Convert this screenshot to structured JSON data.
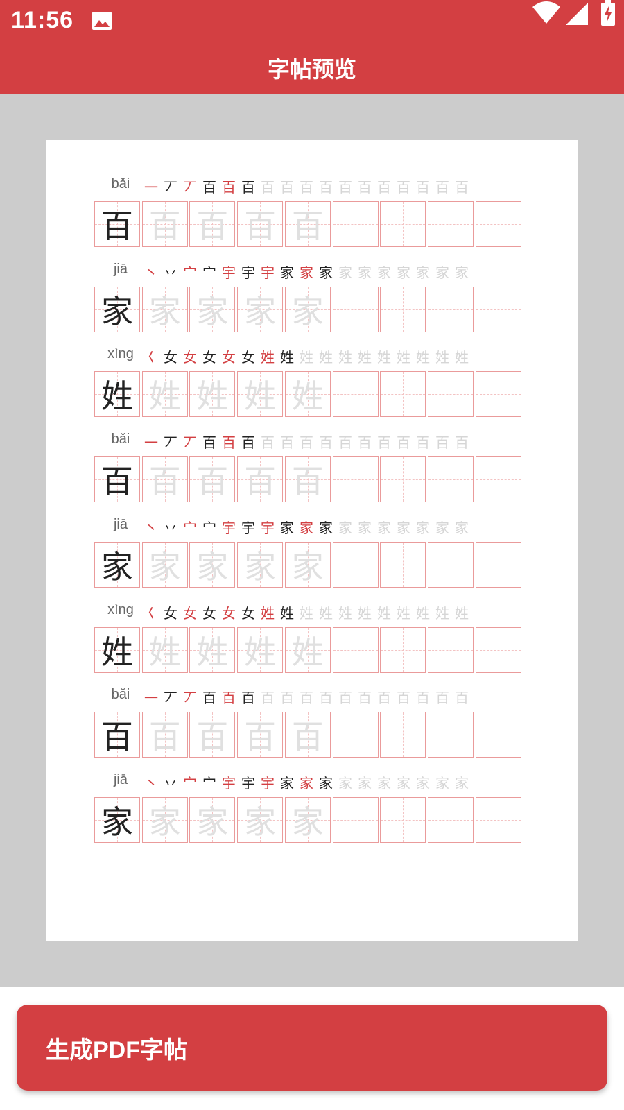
{
  "status_bar": {
    "time": "11:56",
    "icons": [
      "image-icon",
      "wifi-icon",
      "signal-icon",
      "battery-charging-icon"
    ]
  },
  "app_bar": {
    "title": "字帖预览"
  },
  "colors": {
    "primary": "#d33f42",
    "grid": "#ea9b9b",
    "trace": "#e0e0e0",
    "background": "#cccccc"
  },
  "worksheet": {
    "rows": [
      {
        "pinyin": "bǎi",
        "char": "百",
        "strokes": [
          "一",
          "丆",
          "丆",
          "百",
          "百",
          "百"
        ],
        "red_at": [
          0,
          1,
          2,
          3,
          4,
          5
        ],
        "ghost_count": 11
      },
      {
        "pinyin": "jiā",
        "char": "家",
        "strokes": [
          "丶",
          "丷",
          "宀",
          "宀",
          "宇",
          "宇",
          "宇",
          "家",
          "家",
          "家"
        ],
        "red_at": [
          0,
          1,
          2,
          3,
          4,
          5,
          6,
          7,
          8,
          9
        ],
        "ghost_count": 7
      },
      {
        "pinyin": "xìng",
        "char": "姓",
        "strokes": [
          "𡿨",
          "女",
          "女",
          "女",
          "女",
          "女",
          "姓",
          "姓"
        ],
        "red_at": [
          0,
          1,
          2,
          3,
          4,
          5,
          6,
          7
        ],
        "ghost_count": 9
      },
      {
        "pinyin": "bǎi",
        "char": "百",
        "strokes": [
          "一",
          "丆",
          "丆",
          "百",
          "百",
          "百"
        ],
        "red_at": [
          0,
          1,
          2,
          3,
          4,
          5
        ],
        "ghost_count": 11
      },
      {
        "pinyin": "jiā",
        "char": "家",
        "strokes": [
          "丶",
          "丷",
          "宀",
          "宀",
          "宇",
          "宇",
          "宇",
          "家",
          "家",
          "家"
        ],
        "red_at": [
          0,
          1,
          2,
          3,
          4,
          5,
          6,
          7,
          8,
          9
        ],
        "ghost_count": 7
      },
      {
        "pinyin": "xìng",
        "char": "姓",
        "strokes": [
          "𡿨",
          "女",
          "女",
          "女",
          "女",
          "女",
          "姓",
          "姓"
        ],
        "red_at": [
          0,
          1,
          2,
          3,
          4,
          5,
          6,
          7
        ],
        "ghost_count": 9
      },
      {
        "pinyin": "bǎi",
        "char": "百",
        "strokes": [
          "一",
          "丆",
          "丆",
          "百",
          "百",
          "百"
        ],
        "red_at": [
          0,
          1,
          2,
          3,
          4,
          5
        ],
        "ghost_count": 11
      },
      {
        "pinyin": "jiā",
        "char": "家",
        "strokes": [
          "丶",
          "丷",
          "宀",
          "宀",
          "宇",
          "宇",
          "宇",
          "家",
          "家",
          "家"
        ],
        "red_at": [
          0,
          1,
          2,
          3,
          4,
          5,
          6,
          7,
          8,
          9
        ],
        "ghost_count": 7
      }
    ],
    "cells_per_row": 9,
    "trace_cells": 4
  },
  "generate_button": {
    "label": "生成PDF字帖"
  }
}
